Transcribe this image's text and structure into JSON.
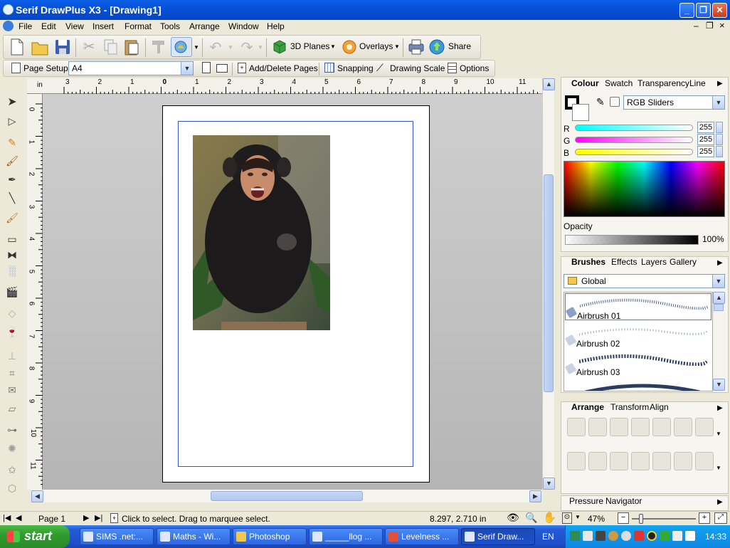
{
  "window": {
    "title": "Serif DrawPlus X3 - [Drawing1]"
  },
  "menu": [
    "File",
    "Edit",
    "View",
    "Insert",
    "Format",
    "Tools",
    "Arrange",
    "Window",
    "Help"
  ],
  "toolbar1": {
    "planes_label": "3D Planes",
    "overlays_label": "Overlays",
    "share_label": "Share"
  },
  "toolbar2": {
    "page_setup_label": "Page Setup",
    "page_size": "A4",
    "add_delete_label": "Add/Delete Pages",
    "snapping_label": "Snapping",
    "drawing_scale_label": "Drawing Scale",
    "options_label": "Options"
  },
  "ruler": {
    "unit": "in",
    "h_ticks": [
      "3",
      "2",
      "1",
      "0",
      "1",
      "2",
      "3",
      "4",
      "5",
      "6",
      "7",
      "8",
      "9",
      "10",
      "11"
    ],
    "v_ticks": [
      "0",
      "1",
      "2",
      "3",
      "4",
      "5",
      "6",
      "7",
      "8",
      "9",
      "10",
      "11"
    ]
  },
  "colour_panel": {
    "tabs": [
      "Colour",
      "Swatch",
      "Transparency",
      "Line"
    ],
    "mode": "RGB Sliders",
    "r_label": "R",
    "g_label": "G",
    "b_label": "B",
    "r": "255",
    "g": "255",
    "b": "255",
    "opacity_label": "Opacity",
    "opacity_value": "100%"
  },
  "brushes_panel": {
    "tabs": [
      "Brushes",
      "Effects",
      "Layers",
      "Gallery"
    ],
    "category": "Global",
    "items": [
      {
        "name": "Airbrush 01"
      },
      {
        "name": "Airbrush 02"
      },
      {
        "name": "Airbrush 03"
      }
    ]
  },
  "arrange_panel": {
    "tabs": [
      "Arrange",
      "Transform",
      "Align"
    ]
  },
  "pressure_panel": {
    "tabs": [
      "Pressure",
      "Navigator"
    ]
  },
  "status": {
    "page": "Page 1",
    "hint": "Click to select. Drag to marquee select.",
    "coords": "8.297,  2.710 in",
    "zoom": "47%"
  },
  "taskbar": {
    "start_label": "start",
    "tasks": [
      "SIMS .net:...",
      "Maths - Wi...",
      "Photoshop",
      "_____llog ...",
      "Levelness ...",
      "Serif Draw..."
    ],
    "lang": "EN",
    "clock": "14:33"
  }
}
